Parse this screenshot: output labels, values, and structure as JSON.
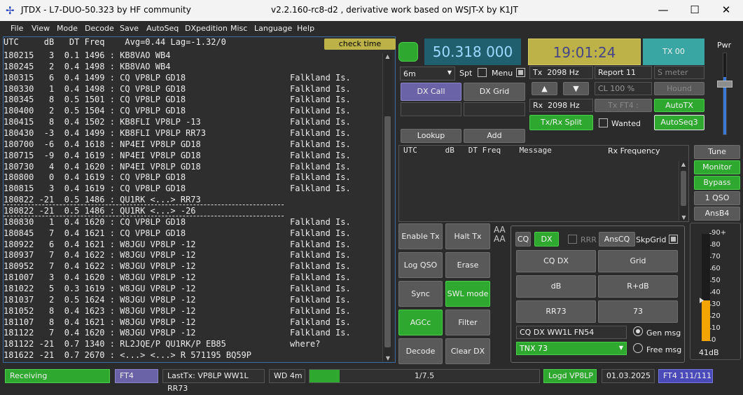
{
  "window": {
    "logo": "✢",
    "title": "JTDX - L7-DUO-50.323  by HF community",
    "subtitle": "v2.2.160-rc8-d2 , derivative work based on WSJT-X by K1JT",
    "minimize": "—",
    "maximize": "☐",
    "close": "✕"
  },
  "menu": [
    "File",
    "View",
    "Mode",
    "Decode",
    "Save",
    "AutoSeq",
    "DXpedition",
    "Misc",
    "Language",
    "Help"
  ],
  "band_activity": {
    "header": "UTC     dB   DT Freq    Avg=0.44 Lag=-1.32/0",
    "check_time": "check time",
    "rows": [
      {
        "t": "180215   3  0.1 1496 : KB8VAO WB4",
        "c": "",
        "dash": false
      },
      {
        "t": "180245   2  0.4 1498 : KB8VAO WB4",
        "c": "",
        "dash": false
      },
      {
        "t": "180315   6  0.4 1499 : CQ VP8LP GD18",
        "c": "Falkland Is.",
        "dash": false
      },
      {
        "t": "180330   1  0.4 1498 : CQ VP8LP GD18",
        "c": "Falkland Is.",
        "dash": false
      },
      {
        "t": "180345   8  0.5 1501 : CQ VP8LP GD18",
        "c": "Falkland Is.",
        "dash": false
      },
      {
        "t": "180400   2  0.5 1504 : CQ VP8LP GD18",
        "c": "Falkland Is.",
        "dash": false
      },
      {
        "t": "180415   8  0.4 1502 : KB8FLI VP8LP -13",
        "c": "Falkland Is.",
        "dash": false
      },
      {
        "t": "180430  -3  0.4 1499 : KB8FLI VP8LP RR73",
        "c": "Falkland Is.",
        "dash": false
      },
      {
        "t": "180700  -6  0.4 1618 : NP4EI VP8LP GD18",
        "c": "Falkland Is.",
        "dash": false
      },
      {
        "t": "180715  -9  0.4 1619 : NP4EI VP8LP GD18",
        "c": "Falkland Is.",
        "dash": false
      },
      {
        "t": "180730   4  0.4 1620 : NP4EI VP8LP GD18",
        "c": "Falkland Is.",
        "dash": false
      },
      {
        "t": "180800   0  0.4 1619 : CQ VP8LP GD18",
        "c": "Falkland Is.",
        "dash": false
      },
      {
        "t": "180815   3  0.4 1619 : CQ VP8LP GD18",
        "c": "Falkland Is.",
        "dash": false
      },
      {
        "t": "180822 -21  0.5 1486 : QU1RK <...> RR73",
        "c": "",
        "dash": true
      },
      {
        "t": "180822 -21  0.5 1486 : QU1RK <...> -26",
        "c": "",
        "dash": true
      },
      {
        "t": "180830   1  0.4 1620 : CQ VP8LP GD18",
        "c": "Falkland Is.",
        "dash": false
      },
      {
        "t": "180845   7  0.4 1621 : CQ VP8LP GD18",
        "c": "Falkland Is.",
        "dash": false
      },
      {
        "t": "180922   6  0.4 1621 : W8JGU VP8LP -12",
        "c": "Falkland Is.",
        "dash": false
      },
      {
        "t": "180937   7  0.4 1622 : W8JGU VP8LP -12",
        "c": "Falkland Is.",
        "dash": false
      },
      {
        "t": "180952   7  0.4 1622 : W8JGU VP8LP -12",
        "c": "Falkland Is.",
        "dash": false
      },
      {
        "t": "181007   3  0.4 1620 : W8JGU VP8LP -12",
        "c": "Falkland Is.",
        "dash": false
      },
      {
        "t": "181022   5  0.3 1619 : W8JGU VP8LP -12",
        "c": "Falkland Is.",
        "dash": false
      },
      {
        "t": "181037   2  0.5 1624 : W8JGU VP8LP -12",
        "c": "Falkland Is.",
        "dash": false
      },
      {
        "t": "181052   8  0.4 1623 : W8JGU VP8LP -12",
        "c": "Falkland Is.",
        "dash": false
      },
      {
        "t": "181107   8  0.4 1621 : W8JGU VP8LP -12",
        "c": "Falkland Is.",
        "dash": false
      },
      {
        "t": "181122   7  0.4 1620 : W8JGU VP8LP -12",
        "c": "Falkland Is.",
        "dash": false
      },
      {
        "t": "181122 -21  0.7 1340 : RL2JQE/P QU1RK/P EB85",
        "c": "where?",
        "dash": false
      },
      {
        "t": "181622 -21  0.7 2670 : <...> <...> R 571195 BQ59P",
        "c": "",
        "dash": false
      }
    ]
  },
  "freq": {
    "dial": "50.318 000",
    "clock": "19:01:24",
    "tx_button": "TX 00",
    "pwr_label": "Pwr"
  },
  "controls": {
    "band": "6m",
    "spt": "Spt",
    "menu": "Menu",
    "tx_label": "Tx",
    "tx_hz": "2098 Hz",
    "rx_label": "Rx",
    "rx_hz": "2098 Hz",
    "report": "Report 11",
    "s_meter": "S meter",
    "cl": "CL  100 %",
    "hound": "Hound",
    "tx_ft4": "Tx FT4 :",
    "autotx": "AutoTX",
    "txrx_split": "Tx/Rx Split",
    "wanted": "Wanted",
    "autoseq3": "AutoSeq3",
    "up": "▲",
    "down": "▼",
    "dx_call": "DX Call",
    "dx_grid": "DX Grid",
    "lookup": "Lookup",
    "add": "Add"
  },
  "rx_pane": {
    "header": "UTC      dB   DT Freq    Message",
    "rx_freq": "Rx Frequency"
  },
  "side_buttons": [
    "Tune",
    "Monitor",
    "Bypass",
    "1 QSO",
    "AnsB4"
  ],
  "left_buttons": [
    "Enable Tx",
    "Halt Tx",
    "Log QSO",
    "Erase",
    "Sync",
    "SWL mode",
    "AGCc",
    "Filter",
    "Decode",
    "Clear DX"
  ],
  "az_label": "AA\nAA",
  "msg_panel": {
    "cq": "CQ",
    "dx": "DX",
    "rrr": "RRR",
    "anscq": "AnsCQ",
    "skpgrid": "SkpGrid",
    "buttons": [
      "CQ DX",
      "Grid",
      "dB",
      "R+dB",
      "RR73",
      "73"
    ],
    "gen_text": "CQ DX WW1L FN54",
    "gen_msg": "Gen msg",
    "free_text": "TNX 73",
    "free_msg": "Free msg"
  },
  "meter": {
    "ticks": [
      "90+",
      "80",
      "70",
      "60",
      "50",
      "40",
      "30",
      "20",
      "10",
      "0"
    ],
    "value": "41dB",
    "level": 0.41
  },
  "status": {
    "state": "Receiving",
    "mode": "FT4",
    "last_tx": "LastTx: VP8LP WW1L RR73",
    "wd": "WD 4m",
    "progress": "1/7.5",
    "progress_fraction": 0.13,
    "logd": "Logd VP8LP",
    "date": "01.03.2025",
    "mode_count": "FT4  111/111"
  },
  "colors": {
    "accent_green": "#2ea82e",
    "freq_bg": "#1f5f6e",
    "clock_bg": "#bdb247",
    "tx_bg": "#3aa6a3",
    "purple": "#6a63a8",
    "meter": "#f2a500"
  }
}
